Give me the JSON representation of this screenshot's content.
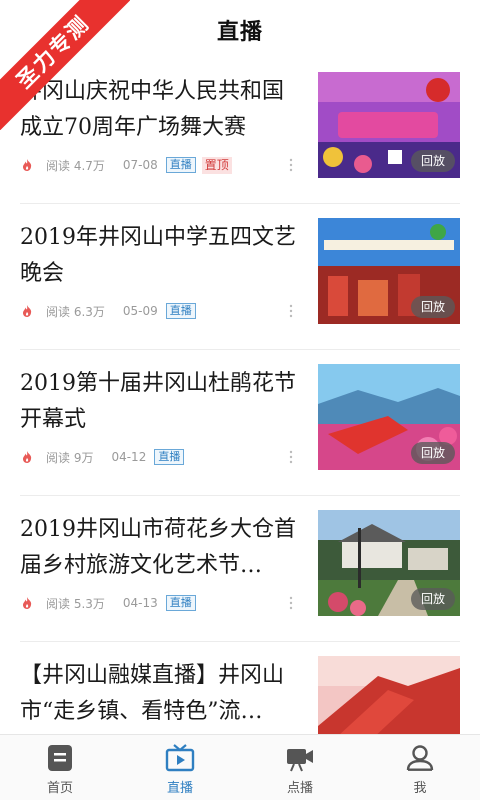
{
  "header": {
    "title": "直播",
    "corner_badge": "圣力专测"
  },
  "colors": {
    "accent": "#2f7fc1",
    "badge": "#e8312e",
    "fire": "#e85a57"
  },
  "feed": [
    {
      "title": "井冈山庆祝中华人民共和国成立70周年广场舞大赛",
      "reads": "阅读 4.7万",
      "date": "07-08",
      "tag": "直播",
      "pin": "置顶",
      "replay": "回放"
    },
    {
      "title": "2019年井冈山中学五四文艺晚会",
      "reads": "阅读 6.3万",
      "date": "05-09",
      "tag": "直播",
      "pin": "",
      "replay": "回放"
    },
    {
      "title": "2019第十届井冈山杜鹃花节开幕式",
      "reads": "阅读 9万",
      "date": "04-12",
      "tag": "直播",
      "pin": "",
      "replay": "回放"
    },
    {
      "title": "2019井冈山市荷花乡大仓首届乡村旅游文化艺术节…",
      "reads": "阅读 5.3万",
      "date": "04-13",
      "tag": "直播",
      "pin": "",
      "replay": "回放"
    },
    {
      "title": "【井冈山融媒直播】井冈山市“走乡镇、看特色”流…",
      "reads": "",
      "date": "",
      "tag": "",
      "pin": "",
      "replay": ""
    }
  ],
  "tabs": [
    {
      "label": "首页",
      "icon": "home-doc-icon"
    },
    {
      "label": "直播",
      "icon": "tv-icon",
      "active": true
    },
    {
      "label": "点播",
      "icon": "video-camera-icon"
    },
    {
      "label": "我",
      "icon": "user-icon"
    }
  ]
}
